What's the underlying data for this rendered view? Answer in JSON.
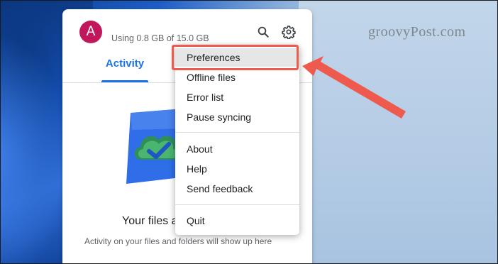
{
  "watermark": "groovyPost.com",
  "header": {
    "avatar_letter": "A",
    "storage_text": "Using 0.8 GB of 15.0 GB",
    "search_icon": "search-icon",
    "settings_icon": "gear-icon"
  },
  "tabs": [
    {
      "label": "Activity",
      "selected": true
    }
  ],
  "empty_state": {
    "title": "Your files a",
    "subtitle": "Activity on your files and folders will show up here"
  },
  "settings_menu": {
    "groups": [
      [
        "Preferences",
        "Offline files",
        "Error list",
        "Pause syncing"
      ],
      [
        "About",
        "Help",
        "Send feedback"
      ],
      [
        "Quit"
      ]
    ],
    "highlighted_item": "Preferences"
  },
  "colors": {
    "accent": "#1a73e8",
    "avatar": "#c2185b",
    "callout": "#ef5a4f"
  }
}
